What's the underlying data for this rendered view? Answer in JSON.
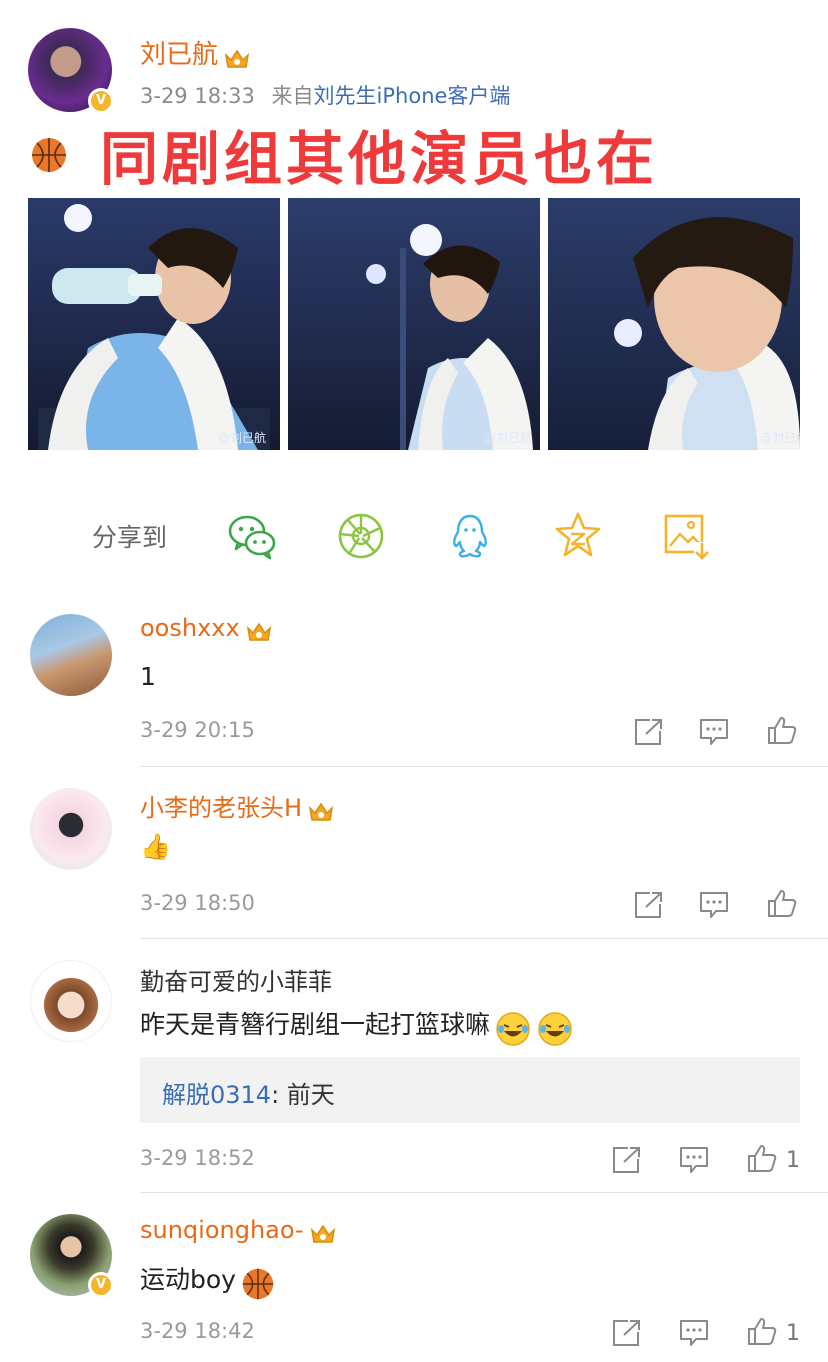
{
  "post": {
    "author": "刘已航",
    "time": "3-29 18:33",
    "source_prefix": "来自",
    "source": "刘先生iPhone客户端",
    "text": "同剧组其他演员也在",
    "verified_badge": "V",
    "photo_watermarks": [
      "@刘已航",
      "@刘已航",
      "@刘已航"
    ]
  },
  "share": {
    "label": "分享到",
    "targets": [
      "wechat-icon",
      "moments-icon",
      "qq-icon",
      "qzone-icon",
      "save-image-icon"
    ]
  },
  "comments": [
    {
      "name": "ooshxxx",
      "text": "1",
      "time": "3-29 20:15",
      "likes": ""
    },
    {
      "name": "小李的老张头H",
      "text": "👍",
      "time": "3-29 18:50",
      "likes": ""
    },
    {
      "name": "勤奋可爱的小菲菲",
      "text": "昨天是青簪行剧组一起打篮球嘛",
      "time": "3-29 18:52",
      "likes": "1",
      "reply": {
        "name": "解脱0314",
        "text": ": 前天"
      }
    },
    {
      "name": "sunqionghao-",
      "text": "运动boy",
      "time": "3-29 18:42",
      "likes": "1"
    }
  ],
  "colors": {
    "username": "#e86a17",
    "title": "#ee3a3a",
    "link": "#3b6db2",
    "wechat": "#3aa84a",
    "qq": "#3ab0e8",
    "qzone": "#f5b428"
  }
}
